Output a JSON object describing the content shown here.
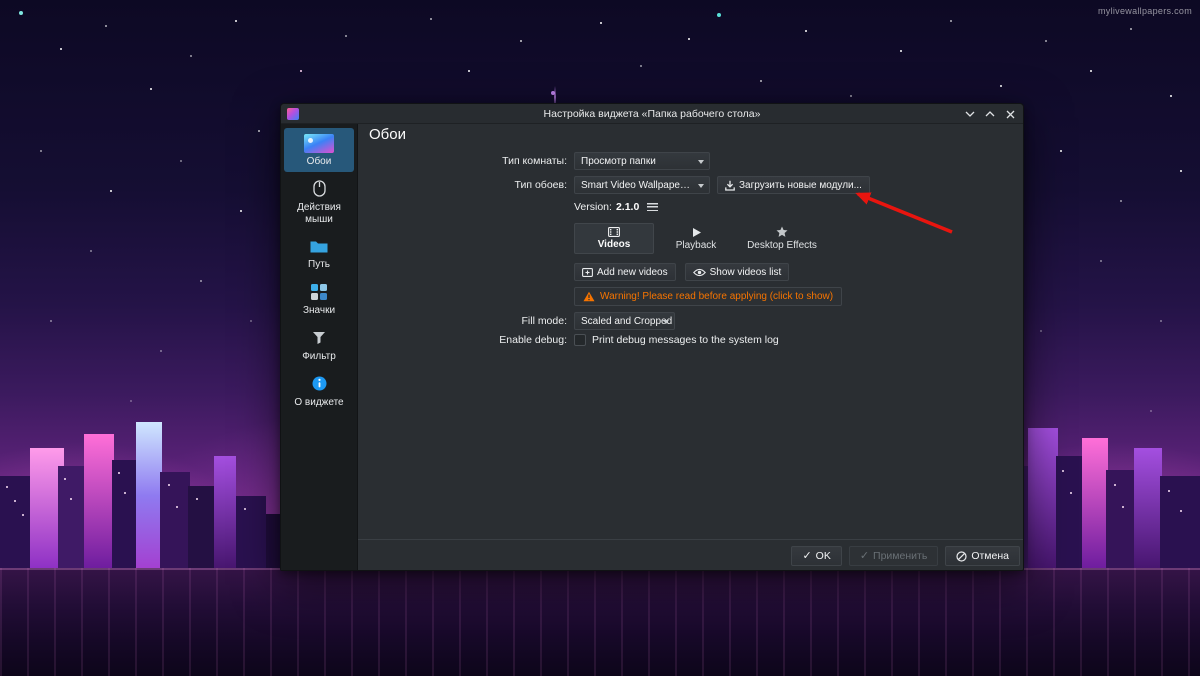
{
  "wallpaper": {
    "watermark": "mylivewallpapers.com"
  },
  "window": {
    "title": "Настройка виджета «Папка рабочего стола»",
    "sidebar": {
      "items": [
        {
          "label": "Обои"
        },
        {
          "label": "Действия мыши"
        },
        {
          "label": "Путь"
        },
        {
          "label": "Значки"
        },
        {
          "label": "Фильтр"
        },
        {
          "label": "О виджете"
        }
      ]
    },
    "content": {
      "heading": "Обои",
      "room_type": {
        "label": "Тип комнаты:",
        "value": "Просмотр папки"
      },
      "wallpaper_type": {
        "label": "Тип обоев:",
        "value": "Smart Video Wallpaper Reborn"
      },
      "get_new_button": "Загрузить новые модули...",
      "version": {
        "label": "Version:",
        "value": "2.1.0"
      },
      "tabs": [
        {
          "label": "Videos"
        },
        {
          "label": "Playback"
        },
        {
          "label": "Desktop Effects"
        }
      ],
      "add_videos_button": "Add new videos",
      "show_list_button": "Show videos list",
      "warning": "Warning! Please read before applying (click to show)",
      "fill_mode": {
        "label": "Fill mode:",
        "value": "Scaled and Cropped"
      },
      "debug": {
        "label": "Enable debug:",
        "checkbox_label": "Print debug messages to the system log"
      }
    },
    "footer": {
      "ok": "OK",
      "apply": "Применить",
      "cancel": "Отмена"
    },
    "colors": {
      "accent": "#3daee9",
      "warning": "#f67400",
      "annotation_arrow": "#e8150f"
    }
  }
}
